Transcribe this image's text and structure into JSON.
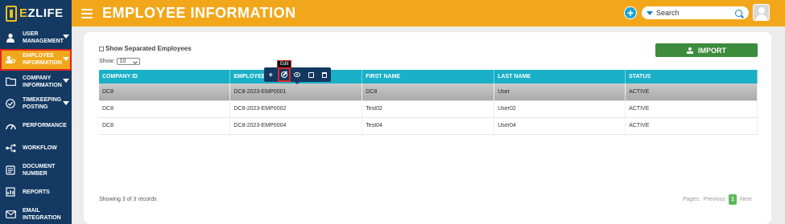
{
  "app": {
    "logo_prefix": "E",
    "logo_text": "ZLIFE",
    "page_title": "EMPLOYEE INFORMATION"
  },
  "header": {
    "search_value": "Search",
    "add_label": "+"
  },
  "sidebar": {
    "items": [
      {
        "label": "USER MANAGEMENT",
        "icon": "user-icon",
        "chevron": true,
        "active": false
      },
      {
        "label": "EMPLOYEE INFORMATION",
        "icon": "employee-icon",
        "chevron": true,
        "active": true
      },
      {
        "label": "COMPANY INFORMATION",
        "icon": "folder-icon",
        "chevron": true,
        "active": false
      },
      {
        "label": "TIMEKEEPING POSTING",
        "icon": "check-circle-icon",
        "chevron": true,
        "active": false
      },
      {
        "label": "PERFORMANCE",
        "icon": "gauge-icon",
        "chevron": false,
        "active": false
      },
      {
        "label": "WORKFLOW",
        "icon": "workflow-icon",
        "chevron": false,
        "active": false
      },
      {
        "label": "DOCUMENT NUMBER",
        "icon": "document-icon",
        "chevron": false,
        "active": false
      },
      {
        "label": "REPORTS",
        "icon": "reports-icon",
        "chevron": false,
        "active": false
      },
      {
        "label": "EMAIL INTEGRATION",
        "icon": "mail-icon",
        "chevron": false,
        "active": false
      }
    ]
  },
  "main": {
    "show_separated_label": "Show Separated Employees",
    "show_label": "Show:",
    "page_size": "10",
    "import_label": "IMPORT",
    "toolbar_tooltip": "Edit",
    "columns": [
      "COMPANY ID",
      "EMPLOYEE",
      "FIRST NAME",
      "LAST NAME",
      "STATUS"
    ],
    "rows": [
      [
        "DC8",
        "DC8-2023-EMP0001",
        "DC8",
        "User",
        "ACTIVE"
      ],
      [
        "DC8",
        "DC8-2023-EMP0002",
        "Test02",
        "User02",
        "ACTIVE"
      ],
      [
        "DC8",
        "DC8-2023-EMP0004",
        "Test04",
        "User04",
        "ACTIVE"
      ]
    ],
    "records_text": "Showing 3 of 3 records",
    "pager": {
      "label": "Pages:",
      "previous": "Previous",
      "current": "1",
      "next": "Next"
    }
  },
  "colors": {
    "sidebar": "#143a63",
    "header": "#f2a71b",
    "table_header": "#1ab0c8",
    "import": "#3d8b3d"
  }
}
